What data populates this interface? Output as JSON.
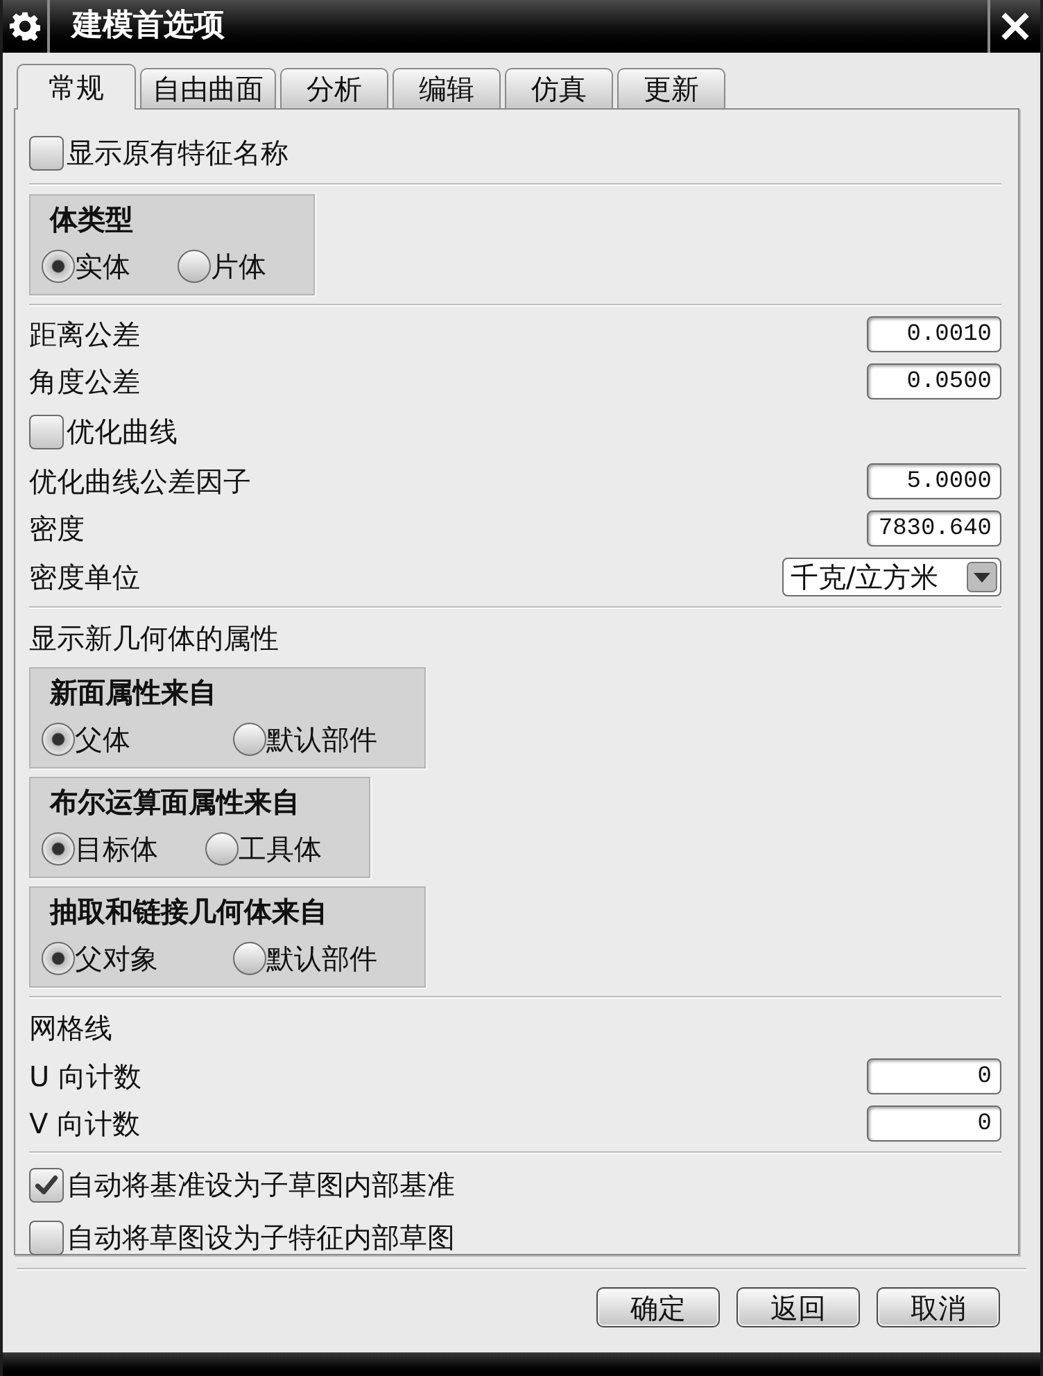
{
  "window": {
    "title": "建模首选项"
  },
  "tabs": [
    {
      "label": "常规",
      "selected": true
    },
    {
      "label": "自由曲面",
      "selected": false
    },
    {
      "label": "分析",
      "selected": false
    },
    {
      "label": "编辑",
      "selected": false
    },
    {
      "label": "仿真",
      "selected": false
    },
    {
      "label": "更新",
      "selected": false
    }
  ],
  "sections": [
    {
      "items": [
        {
          "kind": "checkbox",
          "label": "显示原有特征名称",
          "checked": false
        }
      ]
    },
    {
      "items": [
        {
          "kind": "radio_group",
          "title": "体类型",
          "options": [
            {
              "label": "实体",
              "selected": true
            },
            {
              "label": "片体",
              "selected": false
            }
          ]
        }
      ]
    },
    {
      "items": [
        {
          "kind": "number",
          "label": "距离公差",
          "value": "0.0010"
        },
        {
          "kind": "number",
          "label": "角度公差",
          "value": "0.0500"
        },
        {
          "kind": "checkbox",
          "label": "优化曲线",
          "checked": false
        },
        {
          "kind": "number",
          "label": "优化曲线公差因子",
          "value": "5.0000"
        },
        {
          "kind": "number",
          "label": "密度",
          "value": "7830.640"
        },
        {
          "kind": "dropdown",
          "label": "密度单位",
          "value": "千克/立方米"
        }
      ]
    },
    {
      "items": [
        {
          "kind": "heading",
          "label": "显示新几何体的属性"
        },
        {
          "kind": "radio_group",
          "title": "新面属性来自",
          "options": [
            {
              "label": "父体",
              "selected": true
            },
            {
              "label": "默认部件",
              "selected": false
            }
          ]
        },
        {
          "kind": "radio_group",
          "title": "布尔运算面属性来自",
          "options": [
            {
              "label": "目标体",
              "selected": true
            },
            {
              "label": "工具体",
              "selected": false
            }
          ]
        },
        {
          "kind": "radio_group",
          "title": "抽取和链接几何体来自",
          "options": [
            {
              "label": "父对象",
              "selected": true
            },
            {
              "label": "默认部件",
              "selected": false
            }
          ]
        }
      ]
    },
    {
      "items": [
        {
          "kind": "heading",
          "label": "网格线"
        },
        {
          "kind": "number",
          "label": "U 向计数",
          "value": "0"
        },
        {
          "kind": "number",
          "label": "V 向计数",
          "value": "0"
        }
      ]
    },
    {
      "items": [
        {
          "kind": "checkbox",
          "label": "自动将基准设为子草图内部基准",
          "checked": true
        },
        {
          "kind": "checkbox",
          "label": "自动将草图设为子特征内部草图",
          "checked": false
        }
      ]
    }
  ],
  "buttons": [
    "确定",
    "返回",
    "取消"
  ]
}
